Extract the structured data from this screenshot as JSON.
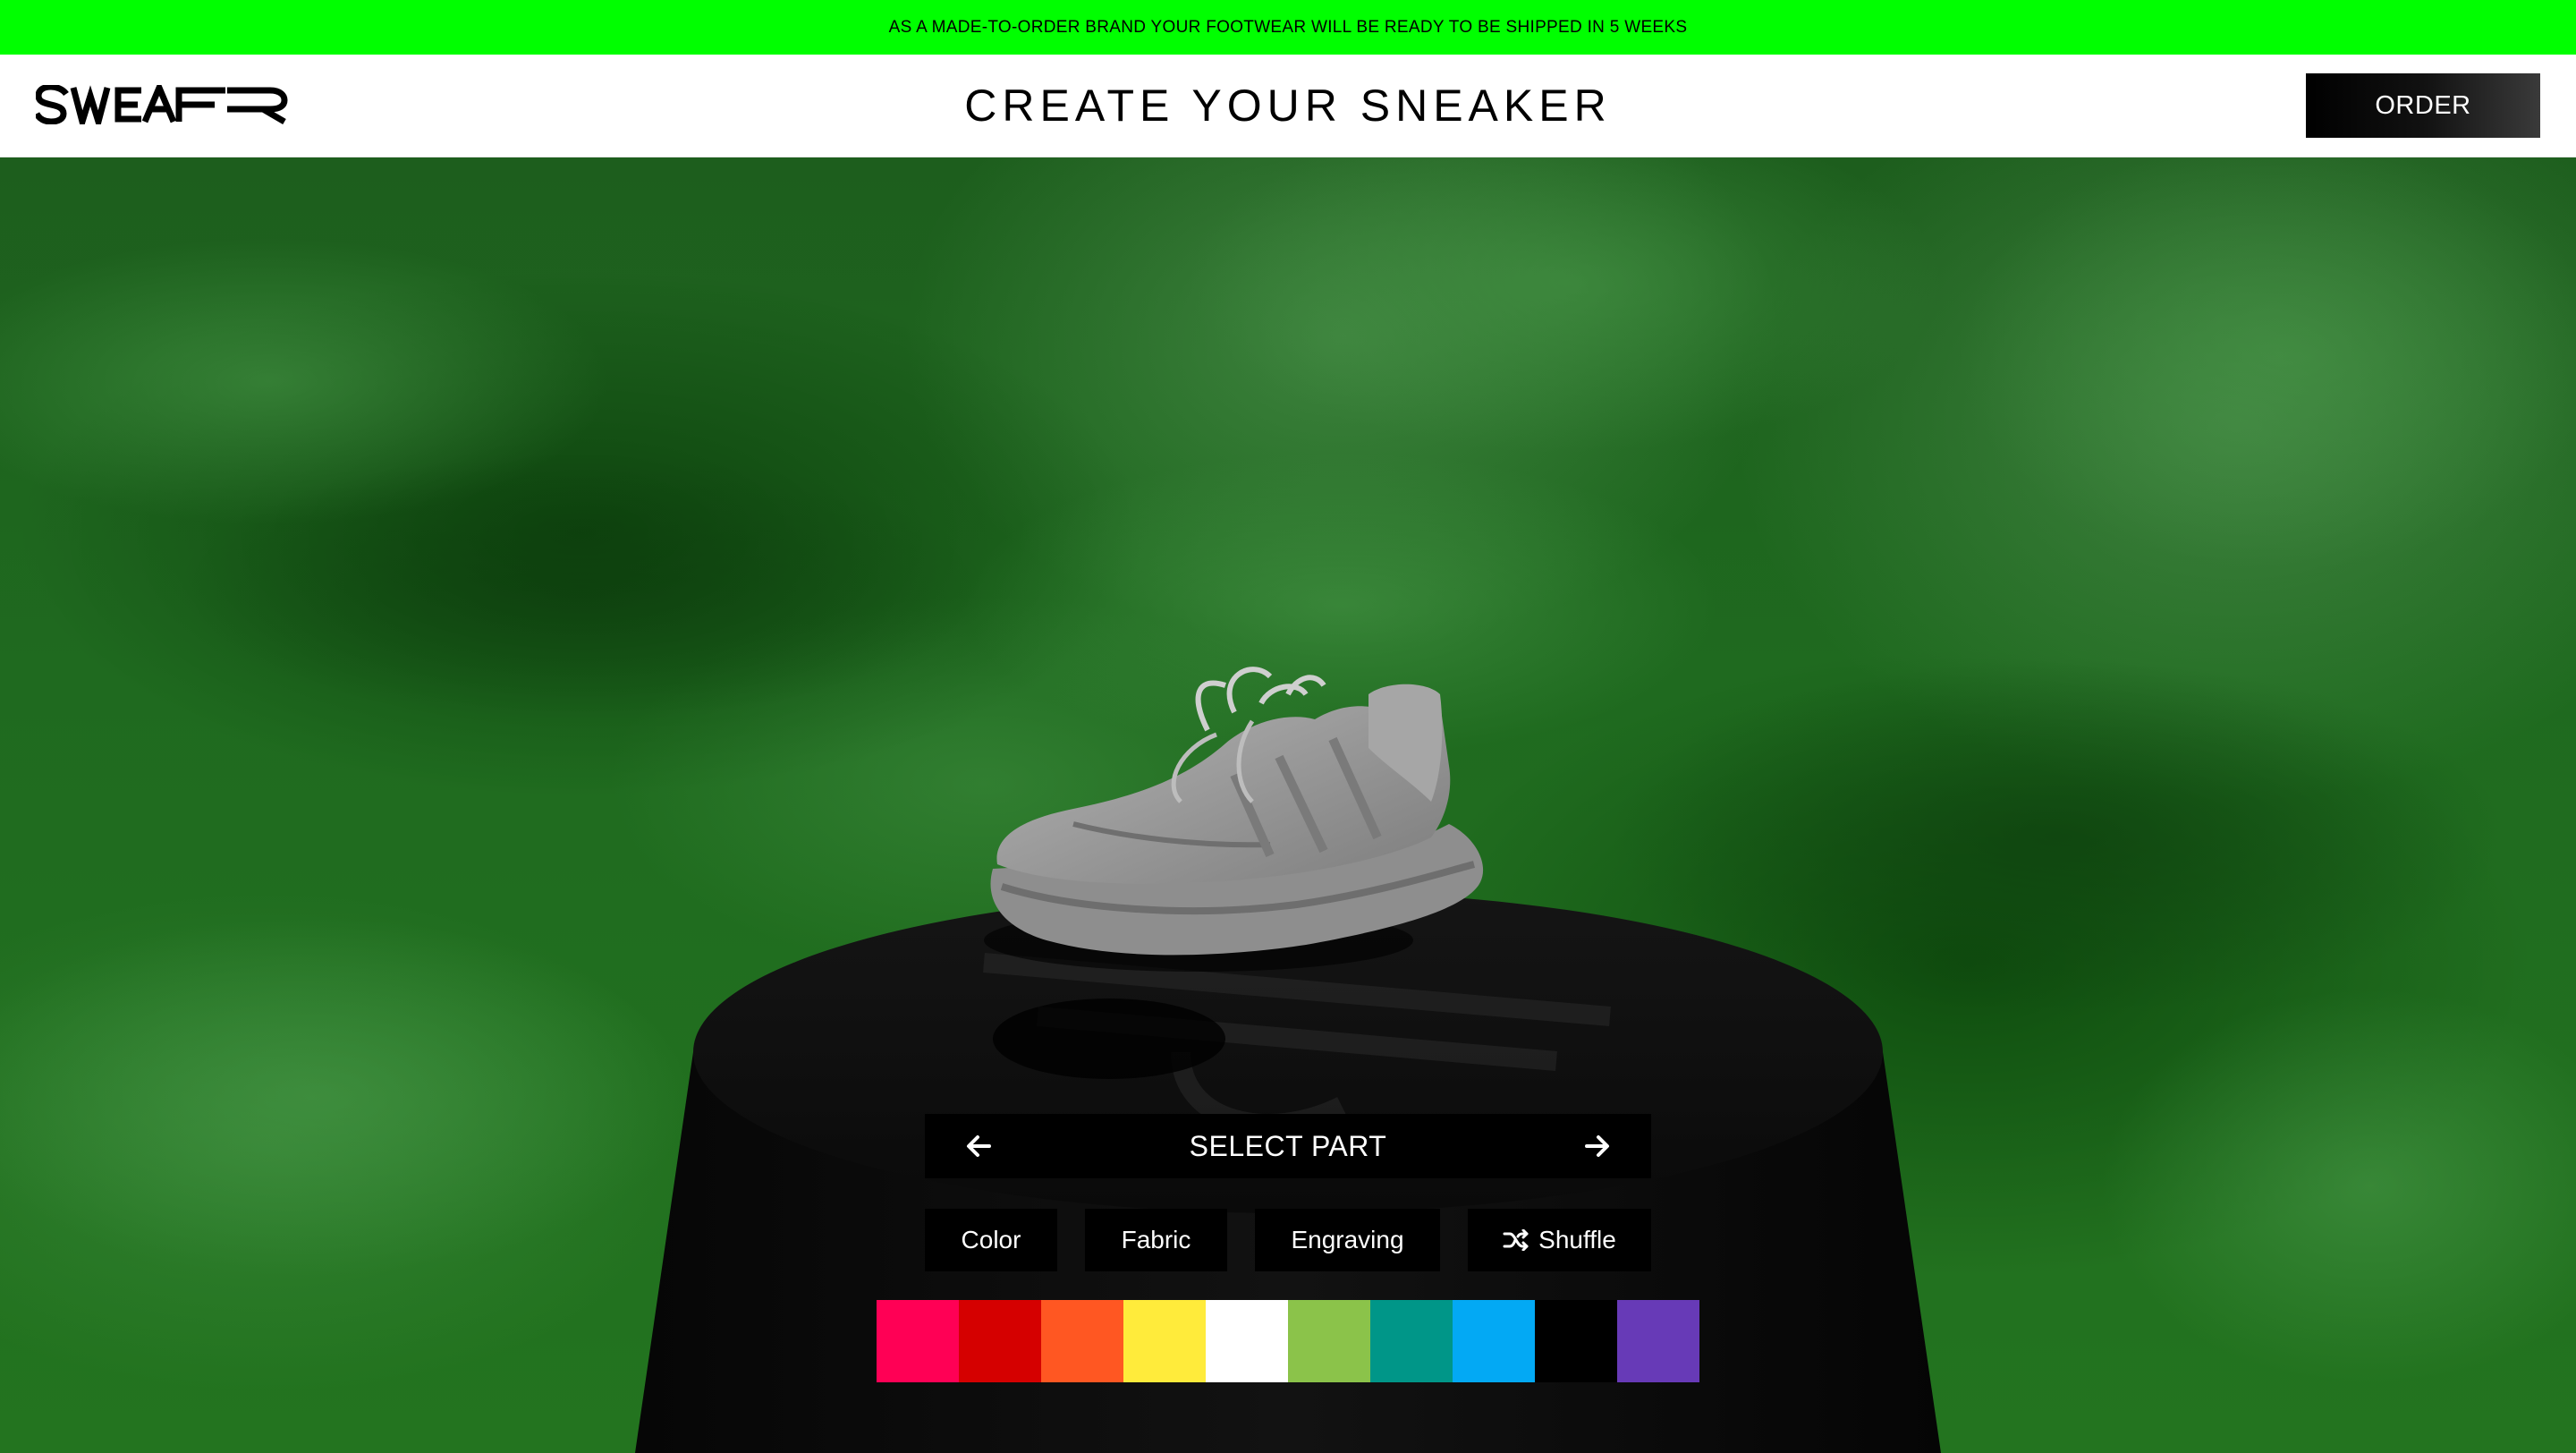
{
  "announcement": {
    "text": "AS A MADE-TO-ORDER BRAND YOUR FOOTWEAR WILL BE READY TO BE SHIPPED IN 5 WEEKS"
  },
  "header": {
    "logo_text": "SWEAR",
    "title": "CREATE YOUR SNEAKER",
    "order_label": "ORDER"
  },
  "configurator": {
    "part_selector_label": "SELECT PART",
    "prev_icon": "arrow-left-icon",
    "next_icon": "arrow-right-icon",
    "tabs": [
      {
        "label": "Color"
      },
      {
        "label": "Fabric"
      },
      {
        "label": "Engraving"
      },
      {
        "label": "Shuffle",
        "icon": "shuffle-icon"
      }
    ],
    "swatches": [
      {
        "color": "#ff0055"
      },
      {
        "color": "#d50000"
      },
      {
        "color": "#ff5722"
      },
      {
        "color": "#ffeb3b"
      },
      {
        "color": "#ffffff"
      },
      {
        "color": "#8bc34a"
      },
      {
        "color": "#009688"
      },
      {
        "color": "#03a9f4"
      },
      {
        "color": "#000000"
      },
      {
        "color": "#673ab7"
      }
    ]
  },
  "colors": {
    "announcement_bg": "#00ff00",
    "stage_green": "#1f6a1f",
    "sneaker": "#9a9a9a"
  }
}
